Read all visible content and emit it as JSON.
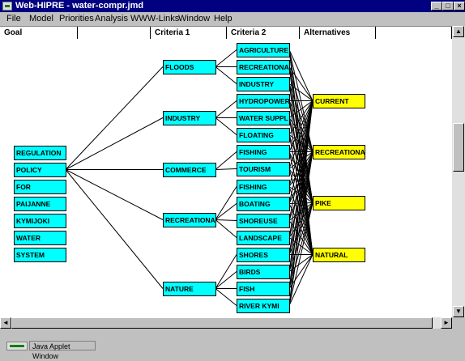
{
  "window": {
    "title": "Web-HIPRE - water-compr.jmd",
    "minimize_glyph": "_",
    "maximize_glyph": "□",
    "close_glyph": "×"
  },
  "menu": [
    "File",
    "Model",
    "Priorities",
    "Analysis",
    "WWW-Links",
    "Window",
    "Help"
  ],
  "columns": [
    "Goal",
    "",
    "Criteria 1",
    "Criteria 2",
    "Alternatives",
    ""
  ],
  "goals": [
    "REGULATION",
    "POLICY",
    "FOR",
    "PAIJANNE",
    "KYMIJOKI",
    "WATER",
    "SYSTEM"
  ],
  "criteria1": [
    "FLOODS",
    "INDUSTRY",
    "COMMERCE",
    "RECREATIONA",
    "NATURE"
  ],
  "criteria2": [
    "AGRICULTURE",
    "RECREATIONA",
    "INDUSTRY",
    "HYDROPOWER",
    "WATER SUPPL",
    "FLOATING",
    "FISHING",
    "TOURISM",
    "FISHING",
    "BOATING",
    "SHOREUSE",
    "LANDSCAPE",
    "SHORES",
    "BIRDS",
    "FISH",
    "RIVER KYMI"
  ],
  "criteria2_parent": [
    0,
    0,
    0,
    1,
    1,
    1,
    2,
    2,
    3,
    3,
    3,
    3,
    4,
    4,
    4,
    4
  ],
  "alternatives": [
    "CURRENT",
    "RECREATIONA",
    "PIKE",
    "NATURAL"
  ],
  "colors": {
    "criteria_fill": "#00ffff",
    "alternative_fill": "#ffff00",
    "titlebar": "#000080"
  },
  "status": {
    "applet_text": "Java Applet Window"
  },
  "scroll": {
    "up": "▲",
    "down": "▼",
    "left": "◄",
    "right": "►"
  }
}
